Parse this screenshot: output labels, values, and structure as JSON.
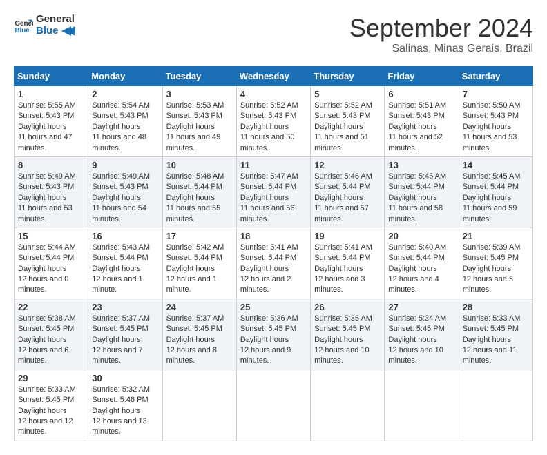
{
  "logo": {
    "line1": "General",
    "line2": "Blue"
  },
  "title": "September 2024",
  "location": "Salinas, Minas Gerais, Brazil",
  "weekdays": [
    "Sunday",
    "Monday",
    "Tuesday",
    "Wednesday",
    "Thursday",
    "Friday",
    "Saturday"
  ],
  "weeks": [
    [
      {
        "day": 1,
        "sunrise": "5:55 AM",
        "sunset": "5:43 PM",
        "daylight": "11 hours and 47 minutes."
      },
      {
        "day": 2,
        "sunrise": "5:54 AM",
        "sunset": "5:43 PM",
        "daylight": "11 hours and 48 minutes."
      },
      {
        "day": 3,
        "sunrise": "5:53 AM",
        "sunset": "5:43 PM",
        "daylight": "11 hours and 49 minutes."
      },
      {
        "day": 4,
        "sunrise": "5:52 AM",
        "sunset": "5:43 PM",
        "daylight": "11 hours and 50 minutes."
      },
      {
        "day": 5,
        "sunrise": "5:52 AM",
        "sunset": "5:43 PM",
        "daylight": "11 hours and 51 minutes."
      },
      {
        "day": 6,
        "sunrise": "5:51 AM",
        "sunset": "5:43 PM",
        "daylight": "11 hours and 52 minutes."
      },
      {
        "day": 7,
        "sunrise": "5:50 AM",
        "sunset": "5:43 PM",
        "daylight": "11 hours and 53 minutes."
      }
    ],
    [
      {
        "day": 8,
        "sunrise": "5:49 AM",
        "sunset": "5:43 PM",
        "daylight": "11 hours and 53 minutes."
      },
      {
        "day": 9,
        "sunrise": "5:49 AM",
        "sunset": "5:43 PM",
        "daylight": "11 hours and 54 minutes."
      },
      {
        "day": 10,
        "sunrise": "5:48 AM",
        "sunset": "5:44 PM",
        "daylight": "11 hours and 55 minutes."
      },
      {
        "day": 11,
        "sunrise": "5:47 AM",
        "sunset": "5:44 PM",
        "daylight": "11 hours and 56 minutes."
      },
      {
        "day": 12,
        "sunrise": "5:46 AM",
        "sunset": "5:44 PM",
        "daylight": "11 hours and 57 minutes."
      },
      {
        "day": 13,
        "sunrise": "5:45 AM",
        "sunset": "5:44 PM",
        "daylight": "11 hours and 58 minutes."
      },
      {
        "day": 14,
        "sunrise": "5:45 AM",
        "sunset": "5:44 PM",
        "daylight": "11 hours and 59 minutes."
      }
    ],
    [
      {
        "day": 15,
        "sunrise": "5:44 AM",
        "sunset": "5:44 PM",
        "daylight": "12 hours and 0 minutes."
      },
      {
        "day": 16,
        "sunrise": "5:43 AM",
        "sunset": "5:44 PM",
        "daylight": "12 hours and 1 minute."
      },
      {
        "day": 17,
        "sunrise": "5:42 AM",
        "sunset": "5:44 PM",
        "daylight": "12 hours and 1 minute."
      },
      {
        "day": 18,
        "sunrise": "5:41 AM",
        "sunset": "5:44 PM",
        "daylight": "12 hours and 2 minutes."
      },
      {
        "day": 19,
        "sunrise": "5:41 AM",
        "sunset": "5:44 PM",
        "daylight": "12 hours and 3 minutes."
      },
      {
        "day": 20,
        "sunrise": "5:40 AM",
        "sunset": "5:44 PM",
        "daylight": "12 hours and 4 minutes."
      },
      {
        "day": 21,
        "sunrise": "5:39 AM",
        "sunset": "5:45 PM",
        "daylight": "12 hours and 5 minutes."
      }
    ],
    [
      {
        "day": 22,
        "sunrise": "5:38 AM",
        "sunset": "5:45 PM",
        "daylight": "12 hours and 6 minutes."
      },
      {
        "day": 23,
        "sunrise": "5:37 AM",
        "sunset": "5:45 PM",
        "daylight": "12 hours and 7 minutes."
      },
      {
        "day": 24,
        "sunrise": "5:37 AM",
        "sunset": "5:45 PM",
        "daylight": "12 hours and 8 minutes."
      },
      {
        "day": 25,
        "sunrise": "5:36 AM",
        "sunset": "5:45 PM",
        "daylight": "12 hours and 9 minutes."
      },
      {
        "day": 26,
        "sunrise": "5:35 AM",
        "sunset": "5:45 PM",
        "daylight": "12 hours and 10 minutes."
      },
      {
        "day": 27,
        "sunrise": "5:34 AM",
        "sunset": "5:45 PM",
        "daylight": "12 hours and 10 minutes."
      },
      {
        "day": 28,
        "sunrise": "5:33 AM",
        "sunset": "5:45 PM",
        "daylight": "12 hours and 11 minutes."
      }
    ],
    [
      {
        "day": 29,
        "sunrise": "5:33 AM",
        "sunset": "5:45 PM",
        "daylight": "12 hours and 12 minutes."
      },
      {
        "day": 30,
        "sunrise": "5:32 AM",
        "sunset": "5:46 PM",
        "daylight": "12 hours and 13 minutes."
      },
      null,
      null,
      null,
      null,
      null
    ]
  ],
  "labels": {
    "sunrise": "Sunrise:",
    "sunset": "Sunset:",
    "daylight": "Daylight hours"
  }
}
